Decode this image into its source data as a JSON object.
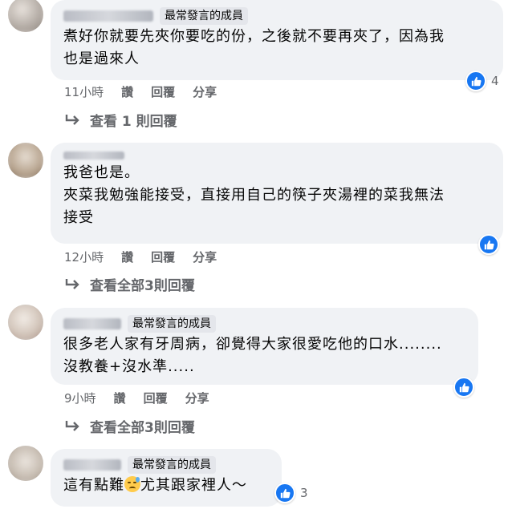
{
  "badge_label": "最常發言的成員",
  "actions": {
    "like": "讚",
    "reply": "回覆",
    "share": "分享"
  },
  "comments": [
    {
      "text": "煮好你就要先夾你要吃的份，之後就不要再夾了，因為我\n也是過來人",
      "time": "11小時",
      "reactions": "4",
      "replies_label": "查看 1 則回覆"
    },
    {
      "text": "我爸也是。\n夾菜我勉強能接受，直接用自己的筷子夾湯裡的菜我無法\n接受",
      "time": "12小時",
      "reactions": "",
      "replies_label": "查看全部3則回覆"
    },
    {
      "text": "很多老人家有牙周病，卻覺得大家很愛吃他的口水........\n沒教養+沒水準.....",
      "time": "9小時",
      "reactions": "",
      "replies_label": "查看全部3則回覆"
    },
    {
      "text_before": "這有點難",
      "text_after": "尤其跟家裡人～",
      "emoji": "sweat-emoji",
      "reactions": "3"
    }
  ],
  "colors": {
    "accent": "#1877f2",
    "bubble": "#f0f2f5",
    "meta": "#65676b"
  }
}
